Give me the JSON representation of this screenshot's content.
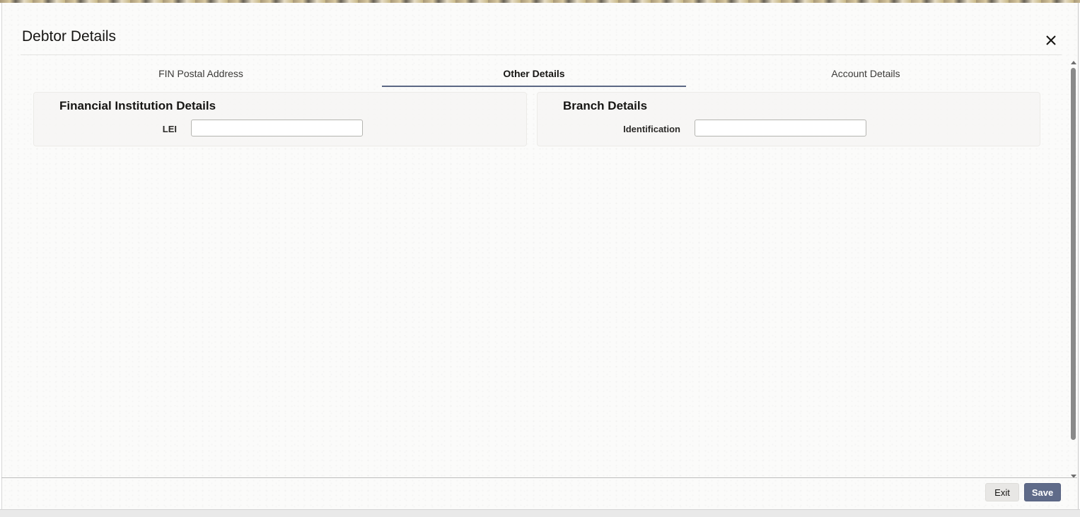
{
  "dialog": {
    "title": "Debtor Details",
    "close_icon": "close-icon"
  },
  "tabs": [
    {
      "label": "FIN Postal Address",
      "active": false
    },
    {
      "label": "Other Details",
      "active": true
    },
    {
      "label": "Account Details",
      "active": false
    }
  ],
  "financial_institution": {
    "heading": "Financial Institution Details",
    "lei_label": "LEI",
    "lei_value": ""
  },
  "branch": {
    "heading": "Branch Details",
    "identification_label": "Identification",
    "identification_value": ""
  },
  "footer": {
    "exit_label": "Exit",
    "save_label": "Save"
  },
  "colors": {
    "tab_indicator": "#5b6784",
    "save_button": "#5f6b89"
  }
}
